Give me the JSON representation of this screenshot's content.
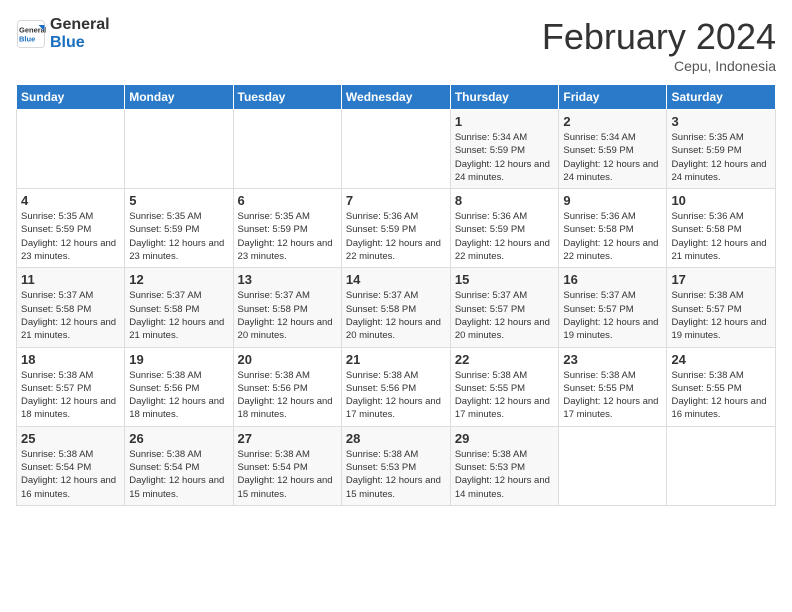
{
  "header": {
    "logo_general": "General",
    "logo_blue": "Blue",
    "month_title": "February 2024",
    "location": "Cepu, Indonesia"
  },
  "days_of_week": [
    "Sunday",
    "Monday",
    "Tuesday",
    "Wednesday",
    "Thursday",
    "Friday",
    "Saturday"
  ],
  "weeks": [
    [
      {
        "day": "",
        "info": ""
      },
      {
        "day": "",
        "info": ""
      },
      {
        "day": "",
        "info": ""
      },
      {
        "day": "",
        "info": ""
      },
      {
        "day": "1",
        "info": "Sunrise: 5:34 AM\nSunset: 5:59 PM\nDaylight: 12 hours and 24 minutes."
      },
      {
        "day": "2",
        "info": "Sunrise: 5:34 AM\nSunset: 5:59 PM\nDaylight: 12 hours and 24 minutes."
      },
      {
        "day": "3",
        "info": "Sunrise: 5:35 AM\nSunset: 5:59 PM\nDaylight: 12 hours and 24 minutes."
      }
    ],
    [
      {
        "day": "4",
        "info": "Sunrise: 5:35 AM\nSunset: 5:59 PM\nDaylight: 12 hours and 23 minutes."
      },
      {
        "day": "5",
        "info": "Sunrise: 5:35 AM\nSunset: 5:59 PM\nDaylight: 12 hours and 23 minutes."
      },
      {
        "day": "6",
        "info": "Sunrise: 5:35 AM\nSunset: 5:59 PM\nDaylight: 12 hours and 23 minutes."
      },
      {
        "day": "7",
        "info": "Sunrise: 5:36 AM\nSunset: 5:59 PM\nDaylight: 12 hours and 22 minutes."
      },
      {
        "day": "8",
        "info": "Sunrise: 5:36 AM\nSunset: 5:59 PM\nDaylight: 12 hours and 22 minutes."
      },
      {
        "day": "9",
        "info": "Sunrise: 5:36 AM\nSunset: 5:58 PM\nDaylight: 12 hours and 22 minutes."
      },
      {
        "day": "10",
        "info": "Sunrise: 5:36 AM\nSunset: 5:58 PM\nDaylight: 12 hours and 21 minutes."
      }
    ],
    [
      {
        "day": "11",
        "info": "Sunrise: 5:37 AM\nSunset: 5:58 PM\nDaylight: 12 hours and 21 minutes."
      },
      {
        "day": "12",
        "info": "Sunrise: 5:37 AM\nSunset: 5:58 PM\nDaylight: 12 hours and 21 minutes."
      },
      {
        "day": "13",
        "info": "Sunrise: 5:37 AM\nSunset: 5:58 PM\nDaylight: 12 hours and 20 minutes."
      },
      {
        "day": "14",
        "info": "Sunrise: 5:37 AM\nSunset: 5:58 PM\nDaylight: 12 hours and 20 minutes."
      },
      {
        "day": "15",
        "info": "Sunrise: 5:37 AM\nSunset: 5:57 PM\nDaylight: 12 hours and 20 minutes."
      },
      {
        "day": "16",
        "info": "Sunrise: 5:37 AM\nSunset: 5:57 PM\nDaylight: 12 hours and 19 minutes."
      },
      {
        "day": "17",
        "info": "Sunrise: 5:38 AM\nSunset: 5:57 PM\nDaylight: 12 hours and 19 minutes."
      }
    ],
    [
      {
        "day": "18",
        "info": "Sunrise: 5:38 AM\nSunset: 5:57 PM\nDaylight: 12 hours and 18 minutes."
      },
      {
        "day": "19",
        "info": "Sunrise: 5:38 AM\nSunset: 5:56 PM\nDaylight: 12 hours and 18 minutes."
      },
      {
        "day": "20",
        "info": "Sunrise: 5:38 AM\nSunset: 5:56 PM\nDaylight: 12 hours and 18 minutes."
      },
      {
        "day": "21",
        "info": "Sunrise: 5:38 AM\nSunset: 5:56 PM\nDaylight: 12 hours and 17 minutes."
      },
      {
        "day": "22",
        "info": "Sunrise: 5:38 AM\nSunset: 5:55 PM\nDaylight: 12 hours and 17 minutes."
      },
      {
        "day": "23",
        "info": "Sunrise: 5:38 AM\nSunset: 5:55 PM\nDaylight: 12 hours and 17 minutes."
      },
      {
        "day": "24",
        "info": "Sunrise: 5:38 AM\nSunset: 5:55 PM\nDaylight: 12 hours and 16 minutes."
      }
    ],
    [
      {
        "day": "25",
        "info": "Sunrise: 5:38 AM\nSunset: 5:54 PM\nDaylight: 12 hours and 16 minutes."
      },
      {
        "day": "26",
        "info": "Sunrise: 5:38 AM\nSunset: 5:54 PM\nDaylight: 12 hours and 15 minutes."
      },
      {
        "day": "27",
        "info": "Sunrise: 5:38 AM\nSunset: 5:54 PM\nDaylight: 12 hours and 15 minutes."
      },
      {
        "day": "28",
        "info": "Sunrise: 5:38 AM\nSunset: 5:53 PM\nDaylight: 12 hours and 15 minutes."
      },
      {
        "day": "29",
        "info": "Sunrise: 5:38 AM\nSunset: 5:53 PM\nDaylight: 12 hours and 14 minutes."
      },
      {
        "day": "",
        "info": ""
      },
      {
        "day": "",
        "info": ""
      }
    ]
  ]
}
